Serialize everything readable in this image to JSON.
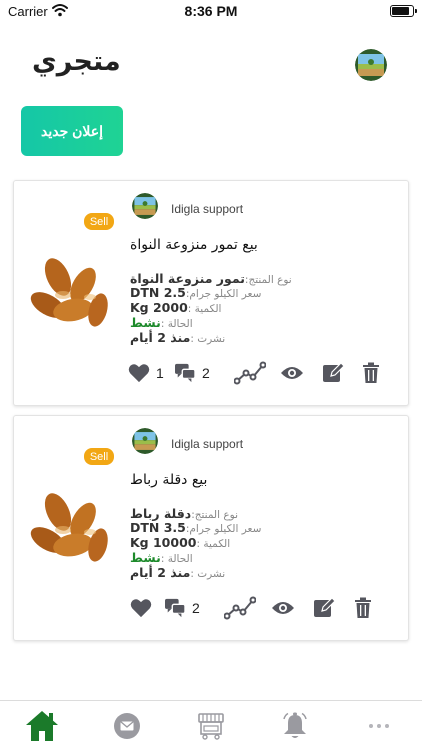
{
  "status_bar": {
    "carrier": "Carrier",
    "time": "8:36 PM",
    "battery_level": 0.9
  },
  "header": {
    "title": "متجري",
    "avatar_icon": "store-logo-icon"
  },
  "new_ad_button": {
    "label": "إعلان جديد",
    "color_from": "#15c7a7",
    "color_to": "#1fd394"
  },
  "listings": [
    {
      "seller": "Idigla support",
      "badge": "Sell",
      "title": "بيع تمور منزوعة النواة",
      "product_label": "نوع المنتج:",
      "product_value": "تمور منزوعة النواة",
      "price_label": "سعر الكيلو جرام:",
      "price_value": "DTN 2.5",
      "quantity_label": "الكمية :",
      "quantity_value": "Kg 2000",
      "status_label": "الحالة :",
      "status_value": "نشط",
      "published_label": "نشرت :",
      "published_value": "منذ 2 أيام",
      "likes": "1",
      "comments": "2"
    },
    {
      "seller": "Idigla support",
      "badge": "Sell",
      "title": "بيع دقلة رباط",
      "product_label": "نوع المنتج:",
      "product_value": "دقلة رباط",
      "price_label": "سعر الكيلو جرام:",
      "price_value": "DTN 3.5",
      "quantity_label": "الكمية :",
      "quantity_value": "Kg 10000",
      "status_label": "الحالة :",
      "status_value": "نشط",
      "published_label": "نشرت :",
      "published_value": "منذ 2 أيام",
      "likes": "",
      "comments": "2"
    }
  ],
  "colors": {
    "accent_green": "#1d8a2b",
    "badge_orange": "#f2a714",
    "icon_gray": "#55565e",
    "home_active": "#1b7a2a"
  },
  "tabbar": {
    "items": [
      {
        "icon": "home-icon",
        "active": true
      },
      {
        "icon": "mail-icon",
        "active": false
      },
      {
        "icon": "market-stall-icon",
        "active": false
      },
      {
        "icon": "bell-icon",
        "active": false
      },
      {
        "icon": "more-icon",
        "active": false
      }
    ]
  }
}
